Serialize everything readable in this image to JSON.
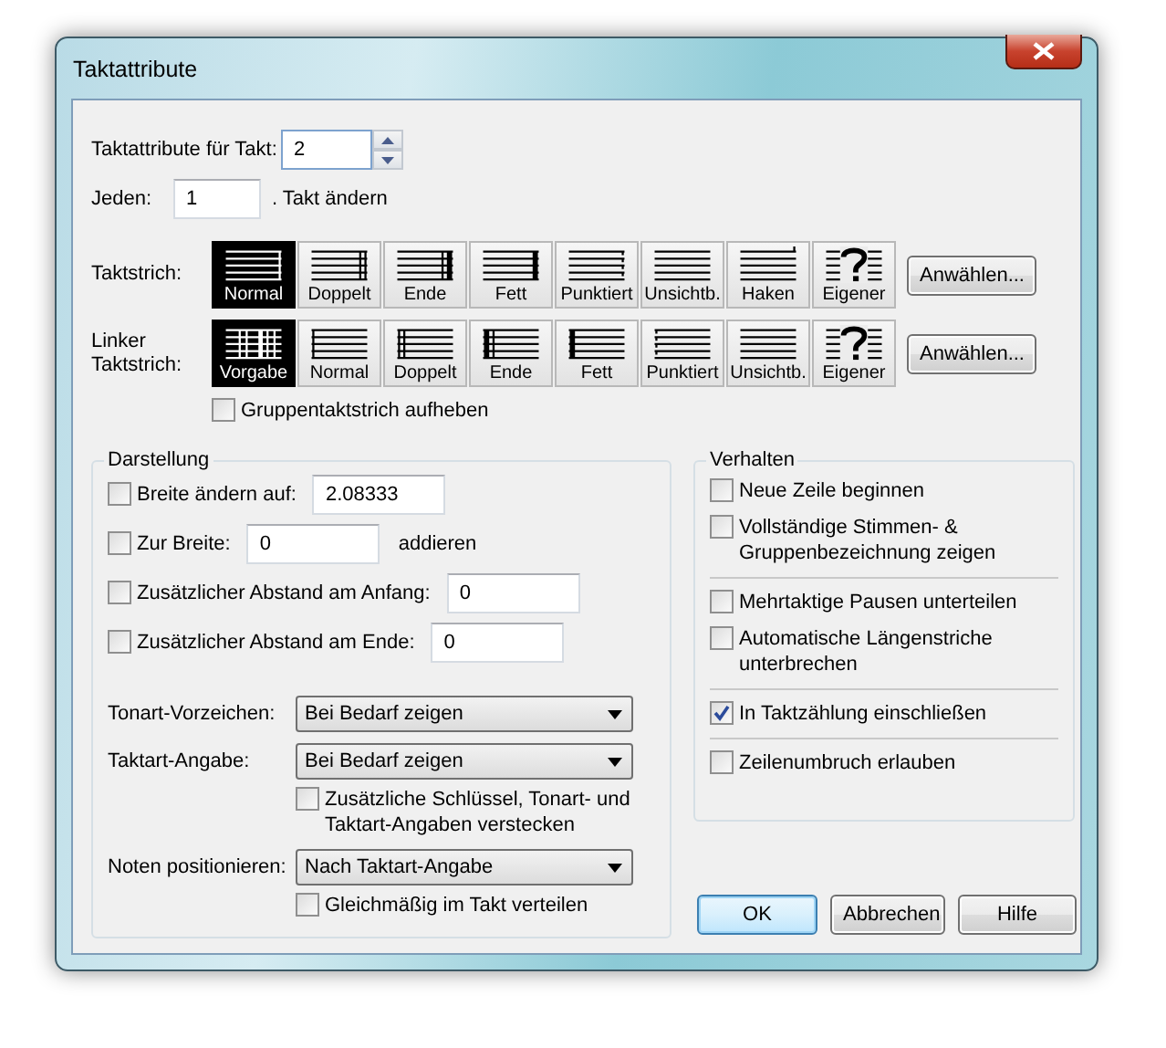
{
  "window": {
    "title": "Taktattribute"
  },
  "measure": {
    "label": "Taktattribute für Takt:",
    "value": "2"
  },
  "every": {
    "label": "Jeden:",
    "value": "1",
    "suffix": ". Takt ändern"
  },
  "barline": {
    "label": "Taktstrich:",
    "button": "Anwählen...",
    "options": [
      {
        "label": "Normal",
        "kind": "normal",
        "selected": true
      },
      {
        "label": "Doppelt",
        "kind": "double",
        "selected": false
      },
      {
        "label": "Ende",
        "kind": "final",
        "selected": false
      },
      {
        "label": "Fett",
        "kind": "heavy",
        "selected": false
      },
      {
        "label": "Punktiert",
        "kind": "dashed",
        "selected": false
      },
      {
        "label": "Unsichtb.",
        "kind": "invisible",
        "selected": false
      },
      {
        "label": "Haken",
        "kind": "tick",
        "selected": false
      },
      {
        "label": "Eigener",
        "kind": "custom",
        "selected": false
      }
    ]
  },
  "left_barline": {
    "label": "Linker Taktstrich:",
    "button": "Anwählen...",
    "options": [
      {
        "label": "Vorgabe",
        "kind": "default",
        "selected": true
      },
      {
        "label": "Normal",
        "kind": "normal",
        "selected": false
      },
      {
        "label": "Doppelt",
        "kind": "double",
        "selected": false
      },
      {
        "label": "Ende",
        "kind": "final",
        "selected": false
      },
      {
        "label": "Fett",
        "kind": "heavy",
        "selected": false
      },
      {
        "label": "Punktiert",
        "kind": "dashed",
        "selected": false
      },
      {
        "label": "Unsichtb.",
        "kind": "invisible",
        "selected": false
      },
      {
        "label": "Eigener",
        "kind": "custom",
        "selected": false
      }
    ]
  },
  "group_barline": {
    "label": "Gruppentaktstrich aufheben",
    "checked": false
  },
  "display": {
    "title": "Darstellung",
    "items": [
      {
        "kind": "check_input",
        "label": "Breite ändern auf:",
        "checked": false,
        "value": "2.08333"
      },
      {
        "kind": "check_input",
        "label": "Zur Breite:",
        "checked": false,
        "value": "0",
        "suffix": "addieren"
      },
      {
        "kind": "check_input",
        "label": "Zusätzlicher Abstand am Anfang:",
        "checked": false,
        "value": "0"
      },
      {
        "kind": "check_input",
        "label": "Zusätzlicher Abstand am Ende:",
        "checked": false,
        "value": "0"
      },
      {
        "kind": "select",
        "label": "Tonart-Vorzeichen:",
        "value": "Bei Bedarf zeigen"
      },
      {
        "kind": "select",
        "label": "Taktart-Angabe:",
        "value": "Bei Bedarf zeigen"
      },
      {
        "kind": "check",
        "label": "Zusätzliche Schlüssel, Tonart- und Taktart-Angaben verstecken",
        "checked": false
      },
      {
        "kind": "select",
        "label": "Noten positionieren:",
        "value": "Nach Taktart-Angabe"
      },
      {
        "kind": "check",
        "label": "Gleichmäßig im Takt verteilen",
        "checked": false
      }
    ]
  },
  "behaviour": {
    "title": "Verhalten",
    "sections": [
      [
        {
          "label": "Neue Zeile beginnen",
          "checked": false
        },
        {
          "label": "Vollständige Stimmen- & Gruppenbezeichnung zeigen",
          "checked": false
        }
      ],
      [
        {
          "label": "Mehrtaktige Pausen unterteilen",
          "checked": false
        },
        {
          "label": "Automatische Längenstriche unterbrechen",
          "checked": false
        }
      ],
      [
        {
          "label": "In Taktzählung einschließen",
          "checked": true
        }
      ],
      [
        {
          "label": "Zeilenumbruch erlauben",
          "checked": false
        }
      ]
    ]
  },
  "buttons": [
    {
      "label": "OK",
      "default": true
    },
    {
      "label": "Abbrechen",
      "default": false
    },
    {
      "label": "Hilfe",
      "default": false
    }
  ]
}
